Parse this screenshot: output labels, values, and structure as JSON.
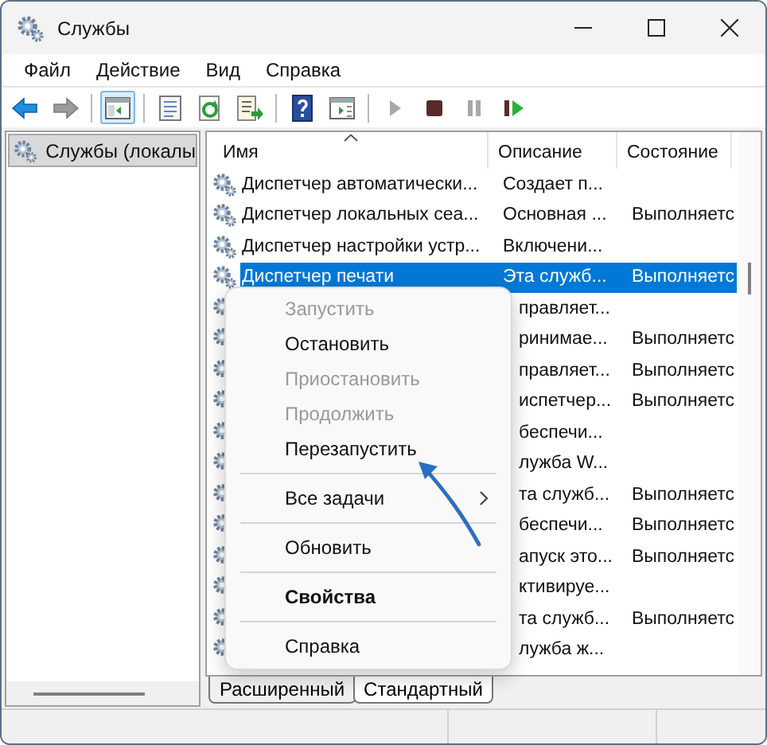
{
  "window": {
    "title": "Службы"
  },
  "menu": [
    "Файл",
    "Действие",
    "Вид",
    "Справка"
  ],
  "toolbar": [
    [
      {
        "kind": "back",
        "disabled": false,
        "selected": false
      },
      {
        "kind": "forward",
        "disabled": true,
        "selected": false
      }
    ],
    [
      {
        "kind": "tree",
        "disabled": false,
        "selected": true
      }
    ],
    [
      {
        "kind": "properties",
        "disabled": false,
        "selected": false
      },
      {
        "kind": "refresh",
        "disabled": false,
        "selected": false
      },
      {
        "kind": "export",
        "disabled": false,
        "selected": false
      }
    ],
    [
      {
        "kind": "help",
        "disabled": false,
        "selected": false
      },
      {
        "kind": "view",
        "disabled": false,
        "selected": false
      }
    ],
    [
      {
        "kind": "start",
        "disabled": true,
        "selected": false
      },
      {
        "kind": "stop",
        "disabled": false,
        "selected": false
      },
      {
        "kind": "pause",
        "disabled": true,
        "selected": false
      },
      {
        "kind": "restart",
        "disabled": false,
        "selected": false
      }
    ]
  ],
  "tree": [
    {
      "label": "Службы (локалы",
      "selected": true
    }
  ],
  "columns": [
    {
      "label": "Имя",
      "sorted": true
    },
    {
      "label": "Описание",
      "sorted": false
    },
    {
      "label": "Состояние",
      "sorted": false
    }
  ],
  "rows": [
    {
      "name": "Диспетчер автоматически...",
      "description": "Создает п...",
      "selected": false
    },
    {
      "name": "Диспетчер локальных сеа...",
      "description": "Основная ...",
      "status": "Выполняетс",
      "selected": false
    },
    {
      "name": "Диспетчер настройки устр...",
      "description": "Включени...",
      "selected": false
    },
    {
      "name": "Диспетчер печати",
      "description": "Эта служб...",
      "status": "Выполняетс",
      "selected": true
    },
    {
      "description": "правляет...",
      "selected": false
    },
    {
      "description": "ринимае...",
      "status": "Выполняетс",
      "selected": false
    },
    {
      "description": "правляет...",
      "status": "Выполняетс",
      "selected": false
    },
    {
      "description": "испетчер...",
      "status": "Выполняетс",
      "selected": false
    },
    {
      "description": "беспечи...",
      "selected": false
    },
    {
      "description": "лужба W...",
      "selected": false
    },
    {
      "description": "та служб...",
      "status": "Выполняетс",
      "selected": false
    },
    {
      "description": "беспечи...",
      "status": "Выполняетс",
      "selected": false
    },
    {
      "description": "апуск это...",
      "status": "Выполняетс",
      "selected": false
    },
    {
      "description": "ктивируе...",
      "selected": false
    },
    {
      "description": "та служб...",
      "status": "Выполняетс",
      "selected": false
    },
    {
      "description": "лужба ж...",
      "selected": false
    }
  ],
  "context_menu": [
    {
      "kind": "item",
      "label": "Запустить",
      "disabled": true,
      "default": false,
      "submenu": false
    },
    {
      "kind": "item",
      "label": "Остановить",
      "disabled": false,
      "default": false,
      "submenu": false
    },
    {
      "kind": "item",
      "label": "Приостановить",
      "disabled": true,
      "default": false,
      "submenu": false
    },
    {
      "kind": "item",
      "label": "Продолжить",
      "disabled": true,
      "default": false,
      "submenu": false
    },
    {
      "kind": "item",
      "label": "Перезапустить",
      "disabled": false,
      "default": false,
      "submenu": false
    },
    {
      "kind": "separator"
    },
    {
      "kind": "item",
      "label": "Все задачи",
      "disabled": false,
      "default": false,
      "submenu": true
    },
    {
      "kind": "separator"
    },
    {
      "kind": "item",
      "label": "Обновить",
      "disabled": false,
      "default": false,
      "submenu": false
    },
    {
      "kind": "separator"
    },
    {
      "kind": "item",
      "label": "Свойства",
      "disabled": false,
      "default": true,
      "submenu": false
    },
    {
      "kind": "separator"
    },
    {
      "kind": "item",
      "label": "Справка",
      "disabled": false,
      "default": false,
      "submenu": false
    }
  ],
  "view_tabs": [
    {
      "label": "Расширенный",
      "selected": false
    },
    {
      "label": "Стандартный",
      "selected": true
    }
  ]
}
